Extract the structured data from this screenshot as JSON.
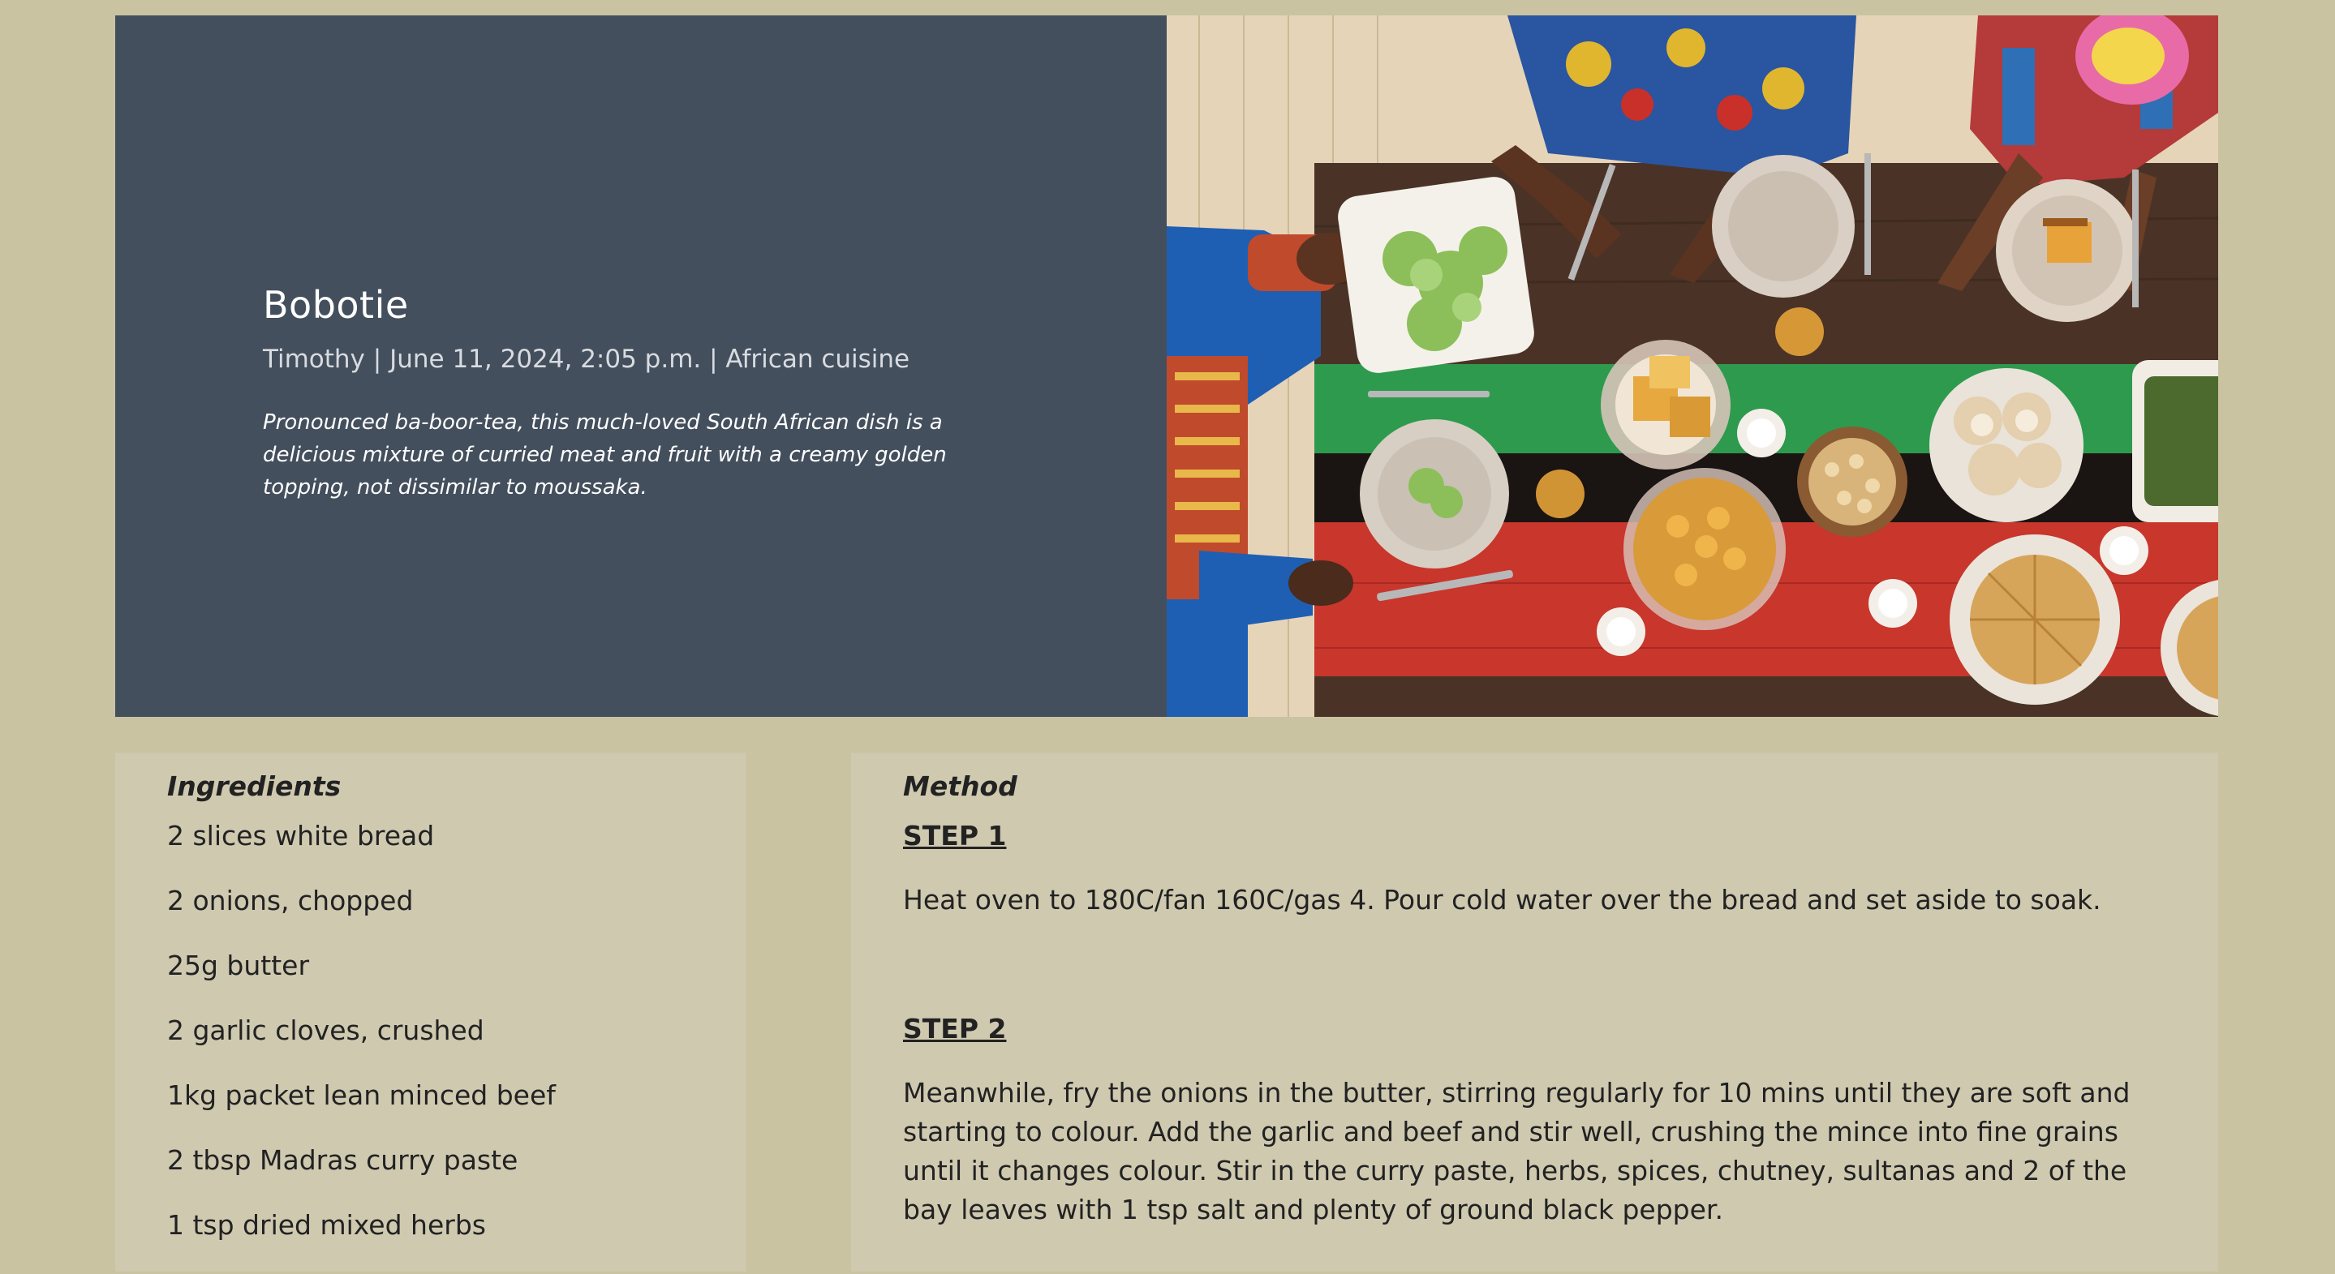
{
  "recipe": {
    "title": "Bobotie",
    "author": "Timothy",
    "date": "June 11, 2024, 2:05 p.m.",
    "cuisine": "African cuisine",
    "separator": " | ",
    "description": "Pronounced ba-boor-tea, this much-loved South African dish is a delicious mixture of curried meat and fruit with a creamy golden topping, not dissimilar to moussaka."
  },
  "ingredients": {
    "heading": "Ingredients",
    "items": [
      "2 slices white bread",
      "2 onions, chopped",
      "25g butter",
      "2 garlic cloves, crushed",
      "1kg packet lean minced beef",
      "2 tbsp Madras curry paste",
      "1 tsp dried mixed herbs"
    ]
  },
  "method": {
    "heading": "Method",
    "steps": [
      {
        "label": "STEP 1",
        "text": "Heat oven to 180C/fan 160C/gas 4. Pour cold water over the bread and set aside to soak."
      },
      {
        "label": "STEP 2",
        "text": "Meanwhile, fry the onions in the butter, stirring regularly for 10 mins until they are soft and starting to colour. Add the garlic and beef and stir well, crushing the mince into fine grains until it changes colour. Stir in the curry paste, herbs, spices, chutney, sultanas and 2 of the bay leaves with 1 tsp salt and plenty of ground black pepper."
      }
    ]
  },
  "colors": {
    "page_background": "#c9c3a2",
    "hero_panel": "#444f5d",
    "card_background": "#cfc9b0"
  }
}
